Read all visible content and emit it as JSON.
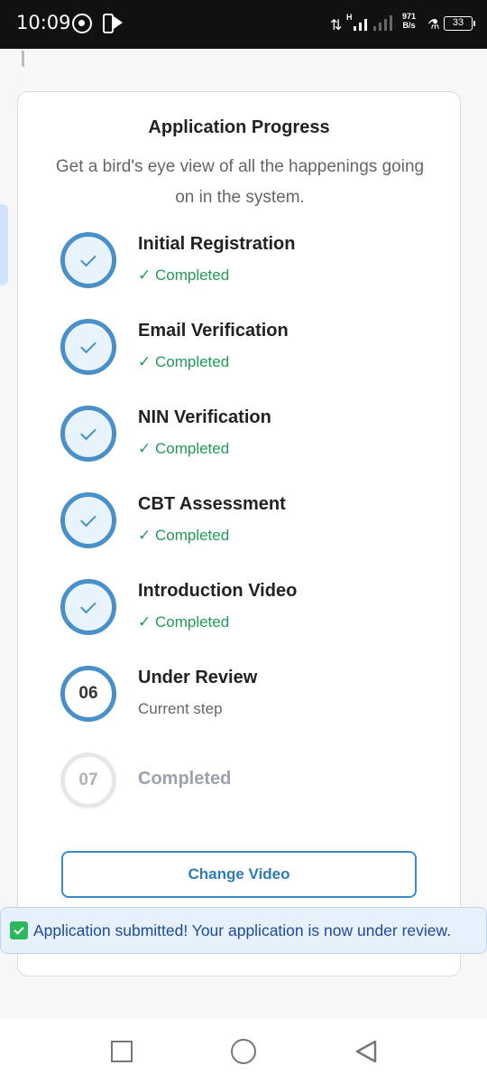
{
  "status_bar": {
    "time": "10:09",
    "network_type": "H",
    "net_rate_value": "971",
    "net_rate_unit": "B/s",
    "battery": "33",
    "icons": [
      "whatsapp-icon",
      "usb-icon",
      "play-icon",
      "data-arrows-icon",
      "signal-icon",
      "flask-icon",
      "battery-icon"
    ]
  },
  "card": {
    "title": "Application Progress",
    "subtitle": "Get a bird's eye view of all the happenings going on in the system."
  },
  "steps": [
    {
      "title": "Initial Registration",
      "status": "✓ Completed",
      "state": "done"
    },
    {
      "title": "Email Verification",
      "status": "✓ Completed",
      "state": "done"
    },
    {
      "title": "NIN Verification",
      "status": "✓ Completed",
      "state": "done"
    },
    {
      "title": "CBT Assessment",
      "status": "✓ Completed",
      "state": "done"
    },
    {
      "title": "Introduction Video",
      "status": "✓ Completed",
      "state": "done"
    },
    {
      "number": "06",
      "title": "Under Review",
      "status": "Current step",
      "state": "current"
    },
    {
      "number": "07",
      "title": "Completed",
      "state": "pending"
    }
  ],
  "button": {
    "label": "Change Video"
  },
  "toast": {
    "message": "Application submitted! Your application is now under review."
  },
  "colors": {
    "accent": "#4a90c8",
    "success": "#1f9d55",
    "toast_bg": "#e7f1fb",
    "toast_text": "#1d4aa0"
  }
}
